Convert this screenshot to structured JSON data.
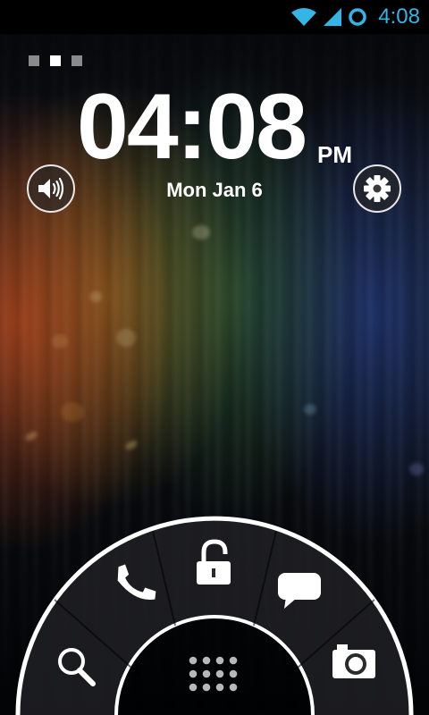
{
  "status_bar": {
    "time": "4:08",
    "icons": [
      "wifi-icon",
      "signal-icon",
      "sync-ring-icon"
    ],
    "accent_color": "#33b5e5"
  },
  "lockscreen": {
    "page_indicator": {
      "count": 3,
      "active_index": 1
    },
    "clock": {
      "time": "04:08",
      "ampm": "PM"
    },
    "date": "Mon Jan 6",
    "left_button_icon": "volume-icon",
    "right_button_icon": "settings-gear-icon"
  },
  "ring_shortcuts": [
    {
      "name": "search",
      "icon": "search-icon"
    },
    {
      "name": "phone",
      "icon": "phone-icon"
    },
    {
      "name": "unlock",
      "icon": "unlock-padlock-icon"
    },
    {
      "name": "messaging",
      "icon": "speech-bubble-icon"
    },
    {
      "name": "camera",
      "icon": "camera-icon"
    }
  ],
  "center_button": {
    "icon": "app-drawer-grid-icon"
  }
}
